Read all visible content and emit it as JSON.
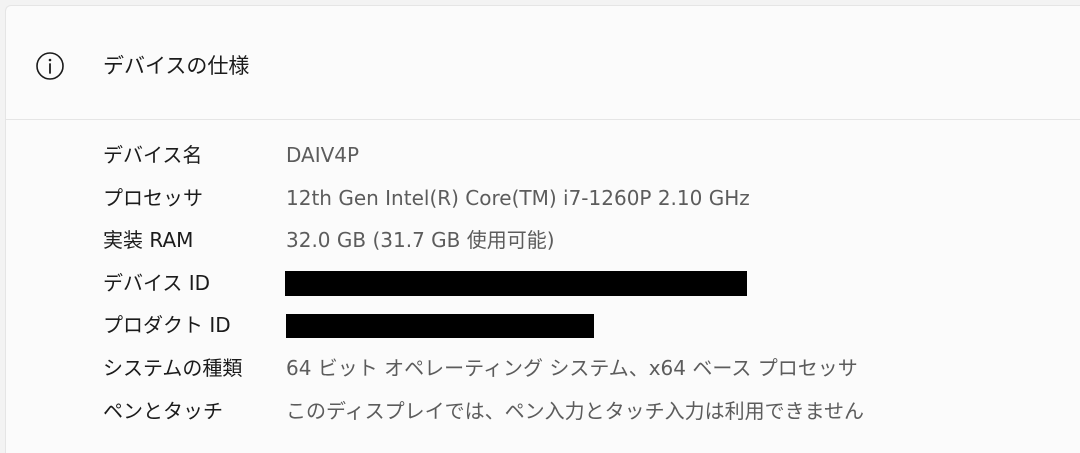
{
  "section": {
    "title": "デバイスの仕様",
    "icon": "info-icon"
  },
  "specs": [
    {
      "label": "デバイス名",
      "value": "DAIV4P"
    },
    {
      "label": "プロセッサ",
      "value": "12th Gen Intel(R) Core(TM) i7-1260P   2.10 GHz"
    },
    {
      "label": "実装 RAM",
      "value": "32.0 GB (31.7 GB 使用可能)"
    },
    {
      "label": "デバイス ID",
      "value": null,
      "redacted": true
    },
    {
      "label": "プロダクト ID",
      "value": null,
      "redacted": true
    },
    {
      "label": "システムの種類",
      "value": "64 ビット オペレーティング システム、x64 ベース プロセッサ"
    },
    {
      "label": "ペンとタッチ",
      "value": "このディスプレイでは、ペン入力とタッチ入力は利用できません"
    }
  ],
  "colors": {
    "background": "#f3f3f3",
    "card": "#fbfbfb",
    "label_text": "#1b1b1b",
    "value_text": "#5c5c5c",
    "redaction": "#000000"
  }
}
